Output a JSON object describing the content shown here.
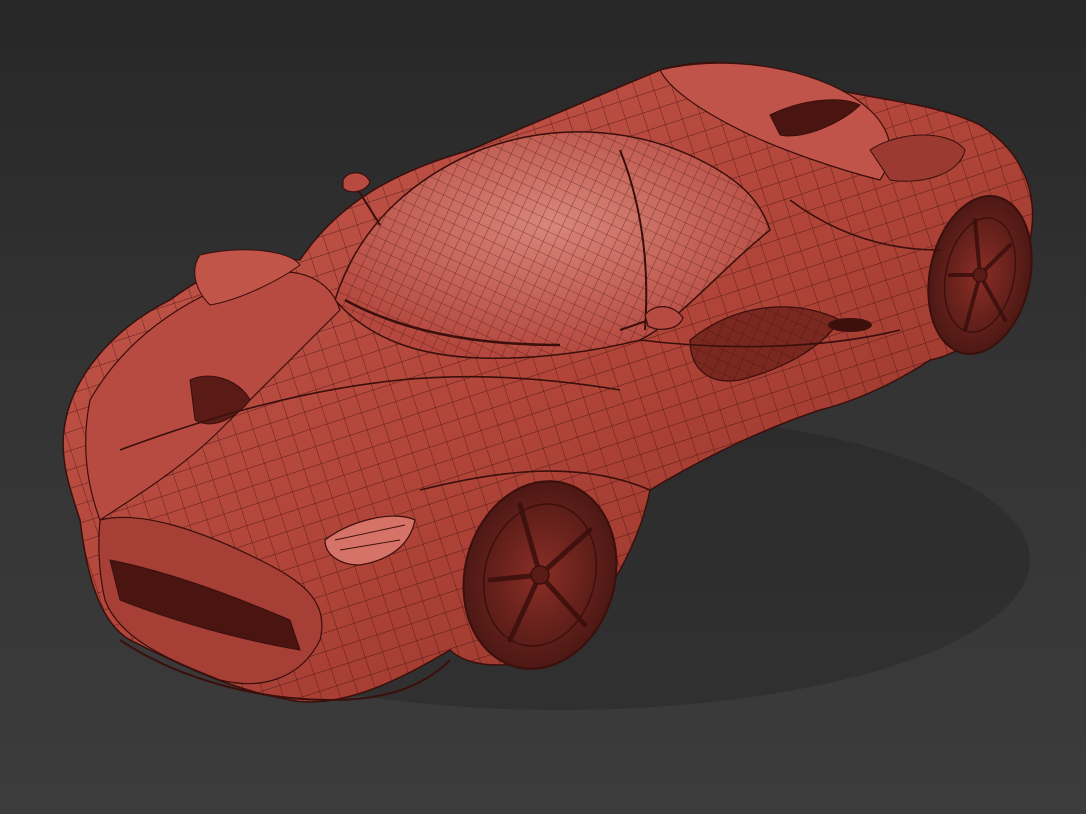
{
  "viewport": {
    "background_top": "#272727",
    "background_bottom": "#3c3c3c"
  },
  "model": {
    "subject": "sports-car-wireframe-render",
    "body_color": "#b4473e",
    "shadow_color": "#6e231d",
    "highlight_color": "#cf6a5e",
    "wire_color": "#3a0f0c",
    "display_mode": "shaded-with-edged-faces"
  }
}
